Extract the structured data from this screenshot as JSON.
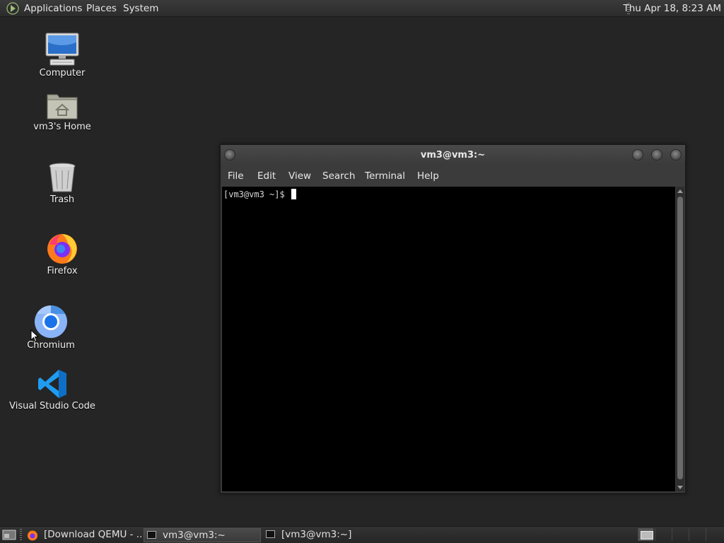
{
  "top_panel": {
    "menus": [
      "Applications",
      "Places",
      "System"
    ],
    "clock": "Thu Apr 18,  8:23 AM"
  },
  "desktop": {
    "icons": [
      {
        "label": "Computer",
        "icon": "computer-icon"
      },
      {
        "label": "vm3's Home",
        "icon": "home-folder-icon"
      },
      {
        "label": "Trash",
        "icon": "trash-icon"
      },
      {
        "label": "Firefox",
        "icon": "firefox-icon"
      },
      {
        "label": "Chromium",
        "icon": "chromium-icon"
      },
      {
        "label": "Visual Studio Code",
        "icon": "vscode-icon"
      }
    ]
  },
  "terminal": {
    "title": "vm3@vm3:~",
    "menu": [
      "File",
      "Edit",
      "View",
      "Search",
      "Terminal",
      "Help"
    ],
    "prompt": "[vm3@vm3 ~]$ "
  },
  "taskbar": {
    "tasks": [
      {
        "label": "[Download QEMU - ...",
        "icon": "firefox-icon",
        "active": false
      },
      {
        "label": "vm3@vm3:~",
        "icon": "terminal-icon",
        "active": true
      },
      {
        "label": "[vm3@vm3:~]",
        "icon": "terminal-icon",
        "active": false
      }
    ]
  },
  "colors": {
    "desktop_bg": "#252525",
    "panel_bg": "#2c2c2c",
    "terminal_bg": "#000000",
    "terminal_fg": "#d8d8d8"
  }
}
